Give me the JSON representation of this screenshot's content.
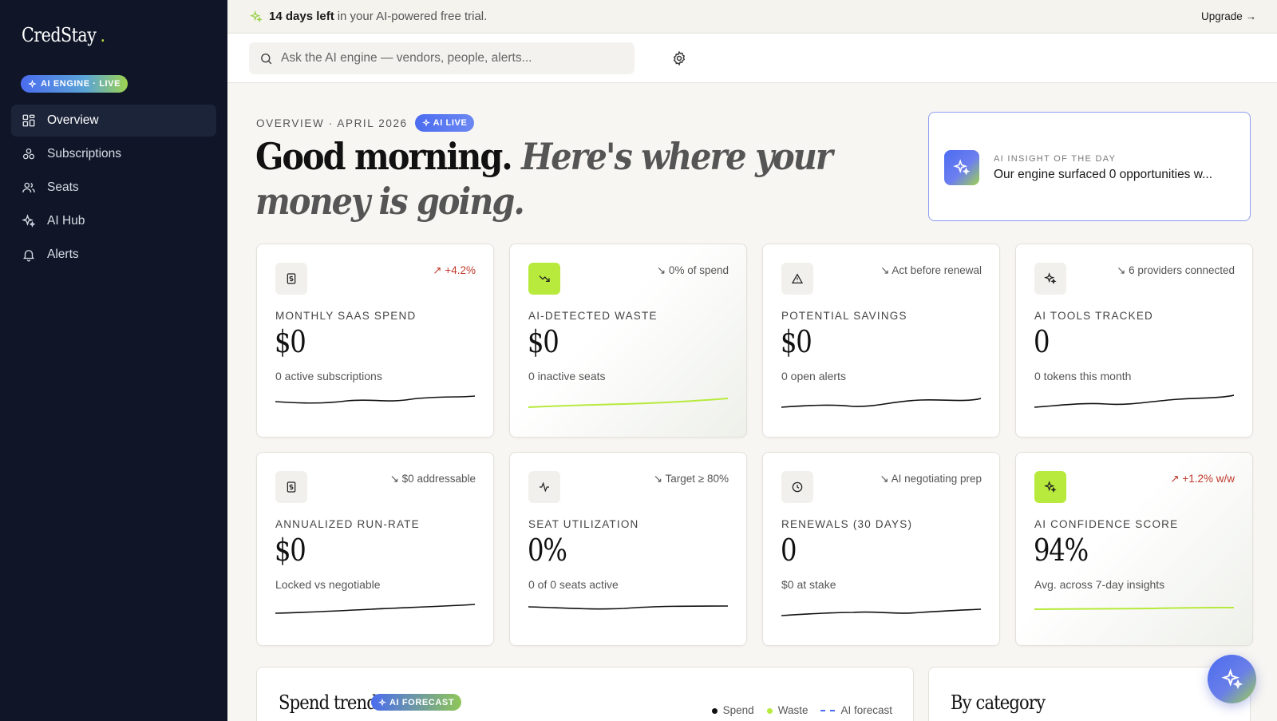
{
  "sidebar": {
    "brand": "CredStay",
    "brand_dot": ".",
    "engine_badge": "AI ENGINE · LIVE",
    "items": [
      {
        "label": "Overview",
        "icon": "grid-icon",
        "active": true
      },
      {
        "label": "Subscriptions",
        "icon": "apps-icon"
      },
      {
        "label": "Seats",
        "icon": "users-icon"
      },
      {
        "label": "AI Hub",
        "icon": "sparkle-icon"
      },
      {
        "label": "Alerts",
        "icon": "bell-icon"
      }
    ]
  },
  "trial": {
    "days": "14 days left",
    "rest": "in your AI-powered free trial.",
    "upgrade": "Upgrade →"
  },
  "search": {
    "placeholder": "Ask the AI engine — vendors, people, alerts..."
  },
  "header": {
    "eyebrow": "OVERVIEW · APRIL 2026",
    "badge": "AI LIVE",
    "greeting": "Good morning.",
    "greeting_italic": "Here's where your money is going."
  },
  "insight": {
    "kicker": "AI INSIGHT OF THE DAY",
    "text": "Our engine surfaced 0 opportunities w..."
  },
  "cards": [
    {
      "label": "MONTHLY SAAS SPEND",
      "value": "$0",
      "sub": "0 active subscriptions",
      "delta": "↗ +4.2%",
      "delta_dir": "up",
      "icon": "dollar-icon",
      "icon_green": false,
      "spark": "dark"
    },
    {
      "label": "AI-DETECTED WASTE",
      "value": "$0",
      "sub": "0 inactive seats",
      "delta": "↘ 0% of spend",
      "delta_dir": "down",
      "icon": "trend-down-icon",
      "icon_green": true,
      "spark": "green"
    },
    {
      "label": "POTENTIAL SAVINGS",
      "value": "$0",
      "sub": "0 open alerts",
      "delta": "↘ Act before renewal",
      "delta_dir": "down",
      "icon": "warning-icon",
      "icon_green": false,
      "spark": "dark"
    },
    {
      "label": "AI TOOLS TRACKED",
      "value": "0",
      "sub": "0 tokens this month",
      "delta": "↘ 6 providers connected",
      "delta_dir": "down",
      "icon": "sparkle-icon",
      "icon_green": false,
      "spark": "dark"
    },
    {
      "label": "ANNUALIZED RUN-RATE",
      "value": "$0",
      "sub": "Locked vs negotiable",
      "delta": "↘ $0 addressable",
      "delta_dir": "down",
      "icon": "dollar-icon",
      "icon_green": false,
      "spark": "dark"
    },
    {
      "label": "SEAT UTILIZATION",
      "value": "0%",
      "sub": "0 of 0 seats active",
      "delta": "↘ Target ≥ 80%",
      "delta_dir": "down",
      "icon": "pulse-icon",
      "icon_green": false,
      "spark": "dark"
    },
    {
      "label": "RENEWALS (30 DAYS)",
      "value": "0",
      "sub": "$0 at stake",
      "delta": "↘ AI negotiating prep",
      "delta_dir": "down",
      "icon": "clock-icon",
      "icon_green": false,
      "spark": "dark"
    },
    {
      "label": "AI CONFIDENCE SCORE",
      "value": "94%",
      "sub": "Avg. across 7-day insights",
      "delta": "↗ +1.2% w/w",
      "delta_dir": "up",
      "icon": "sparkle-icon",
      "icon_green": true,
      "spark": "green"
    }
  ],
  "spend_trend": {
    "title": "Spend trend",
    "badge": "AI FORECAST",
    "legend": [
      {
        "label": "Spend",
        "color": "#111111"
      },
      {
        "label": "Waste",
        "color": "#b7ea3c"
      },
      {
        "label": "AI forecast",
        "color": "#4b6cf0"
      }
    ]
  },
  "by_category": {
    "title": "By category"
  },
  "colors": {
    "sidebar": "#101628",
    "accent": "#4b6cf0",
    "lime": "#b7ea3c"
  }
}
